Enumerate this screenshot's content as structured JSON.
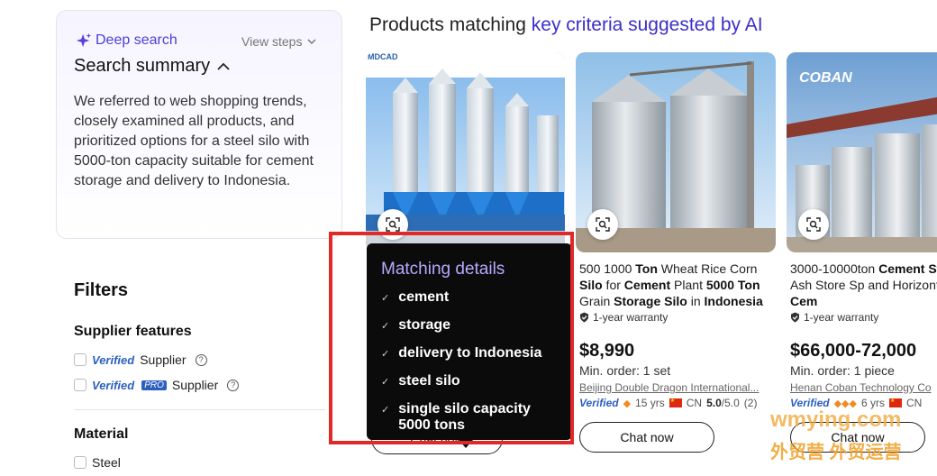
{
  "sidebar": {
    "deep_search_label": "Deep search",
    "view_steps_label": "View steps",
    "summary_title": "Search summary",
    "summary_text": "We referred to web shopping trends, closely examined all products, and prioritized options for a steel silo with 5000-ton capacity suitable for cement storage and delivery to Indonesia.",
    "filters_title": "Filters",
    "supplier_features_title": "Supplier features",
    "verified_word": "Verified",
    "pro_word": "PRO",
    "supplier_word": "Supplier",
    "material_title": "Material",
    "material_first_option": "Steel"
  },
  "main": {
    "heading_prefix": "Products matching ",
    "heading_highlight": "key criteria suggested by AI"
  },
  "products": [
    {
      "logo_text": "MDCAD",
      "chat_label": "Chat now"
    },
    {
      "title_parts": [
        "500 1000 ",
        "Ton",
        " Wheat Rice Corn ",
        "Silo",
        " for ",
        "Cement",
        " Plant ",
        "5000 Ton",
        " Grain ",
        "Storage Silo",
        " in ",
        "Indonesia"
      ],
      "warranty": "1-year warranty",
      "price": "$8,990",
      "moq": "Min. order: 1 set",
      "supplier": "Beijing Double Dragon International...",
      "verified": "Verified",
      "years": "15 yrs",
      "country": "CN",
      "rating": "5.0",
      "rating_total": "/5.0",
      "reviews": "(2)",
      "chat_label": "Chat now"
    },
    {
      "logo_text": "COBAN",
      "title_parts": [
        "3000-10000ton ",
        "Cement",
        " ",
        "Storage",
        " Fly Ash Store Sp",
        " and Horizontal ",
        "Steel Cem"
      ],
      "warranty": "1-year warranty",
      "price": "$66,000-72,000",
      "moq": "Min. order: 1 piece",
      "supplier": "Henan Coban Technology Co",
      "verified": "Verified",
      "years": "6 yrs",
      "country": "CN",
      "chat_label": "Chat now"
    }
  ],
  "tooltip": {
    "title": "Matching details",
    "items": [
      "cement",
      "storage",
      "delivery to Indonesia",
      "steel silo",
      "single silo capacity 5000 tons"
    ]
  },
  "watermark": {
    "line1": "wmying.com",
    "line2": "外贸营 外贸运营"
  },
  "colors": {
    "accent": "#3b2fc9",
    "highlight_box": "#e02a2a",
    "tooltip_bg": "#0b0b0b"
  }
}
